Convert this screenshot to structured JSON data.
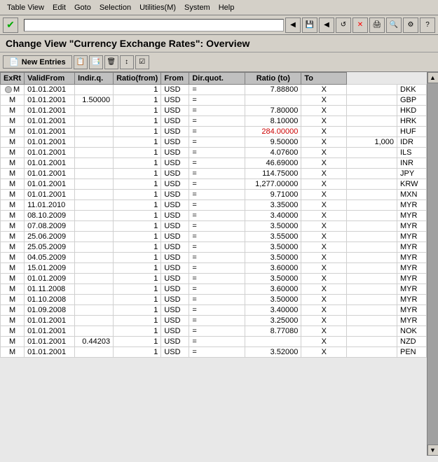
{
  "menubar": {
    "items": [
      {
        "label": "Table View"
      },
      {
        "label": "Edit"
      },
      {
        "label": "Goto"
      },
      {
        "label": "Selection"
      },
      {
        "label": "Utilities(M)"
      },
      {
        "label": "System"
      },
      {
        "label": "Help"
      }
    ]
  },
  "toolbar": {
    "address": ""
  },
  "page": {
    "title": "Change View \"Currency Exchange Rates\": Overview"
  },
  "toolbar2": {
    "new_entries_label": "New Entries"
  },
  "table": {
    "headers": [
      "ExRt",
      "ValidFrom",
      "Indir.q.",
      "Ratio(from)",
      "From",
      "Dir.quot.",
      "Ratio (to)",
      "To"
    ],
    "rows": [
      {
        "exrt": "M",
        "validfrom": "01.01.2001",
        "indirq": "",
        "ratiofrom": "1",
        "from": "USD",
        "eq": "=",
        "dirquot": "7.88800",
        "ratioto": "X",
        "ratio_to": "",
        "to": "DKK",
        "red": false
      },
      {
        "exrt": "M",
        "validfrom": "01.01.2001",
        "indirq": "1.50000",
        "ratiofrom": "1",
        "from": "USD",
        "eq": "=",
        "dirquot": "",
        "ratioto": "X",
        "ratio_to": "",
        "to": "GBP",
        "red": false
      },
      {
        "exrt": "M",
        "validfrom": "01.01.2001",
        "indirq": "",
        "ratiofrom": "1",
        "from": "USD",
        "eq": "=",
        "dirquot": "7.80000",
        "ratioto": "X",
        "ratio_to": "",
        "to": "HKD",
        "red": false
      },
      {
        "exrt": "M",
        "validfrom": "01.01.2001",
        "indirq": "",
        "ratiofrom": "1",
        "from": "USD",
        "eq": "=",
        "dirquot": "8.10000",
        "ratioto": "X",
        "ratio_to": "",
        "to": "HRK",
        "red": false
      },
      {
        "exrt": "M",
        "validfrom": "01.01.2001",
        "indirq": "",
        "ratiofrom": "1",
        "from": "USD",
        "eq": "=",
        "dirquot": "284.00000",
        "ratioto": "X",
        "ratio_to": "",
        "to": "HUF",
        "red": true
      },
      {
        "exrt": "M",
        "validfrom": "01.01.2001",
        "indirq": "",
        "ratiofrom": "1",
        "from": "USD",
        "eq": "=",
        "dirquot": "9.50000",
        "ratioto": "X",
        "ratio_to": "1,000",
        "to": "IDR",
        "red": false
      },
      {
        "exrt": "M",
        "validfrom": "01.01.2001",
        "indirq": "",
        "ratiofrom": "1",
        "from": "USD",
        "eq": "=",
        "dirquot": "4.07600",
        "ratioto": "X",
        "ratio_to": "",
        "to": "ILS",
        "red": false
      },
      {
        "exrt": "M",
        "validfrom": "01.01.2001",
        "indirq": "",
        "ratiofrom": "1",
        "from": "USD",
        "eq": "=",
        "dirquot": "46.69000",
        "ratioto": "X",
        "ratio_to": "",
        "to": "INR",
        "red": false
      },
      {
        "exrt": "M",
        "validfrom": "01.01.2001",
        "indirq": "",
        "ratiofrom": "1",
        "from": "USD",
        "eq": "=",
        "dirquot": "114.75000",
        "ratioto": "X",
        "ratio_to": "",
        "to": "JPY",
        "red": false
      },
      {
        "exrt": "M",
        "validfrom": "01.01.2001",
        "indirq": "",
        "ratiofrom": "1",
        "from": "USD",
        "eq": "=",
        "dirquot": "1,277.00000",
        "ratioto": "X",
        "ratio_to": "",
        "to": "KRW",
        "red": false
      },
      {
        "exrt": "M",
        "validfrom": "01.01.2001",
        "indirq": "",
        "ratiofrom": "1",
        "from": "USD",
        "eq": "=",
        "dirquot": "9.71000",
        "ratioto": "X",
        "ratio_to": "",
        "to": "MXN",
        "red": false
      },
      {
        "exrt": "M",
        "validfrom": "11.01.2010",
        "indirq": "",
        "ratiofrom": "1",
        "from": "USD",
        "eq": "=",
        "dirquot": "3.35000",
        "ratioto": "X",
        "ratio_to": "",
        "to": "MYR",
        "red": false
      },
      {
        "exrt": "M",
        "validfrom": "08.10.2009",
        "indirq": "",
        "ratiofrom": "1",
        "from": "USD",
        "eq": "=",
        "dirquot": "3.40000",
        "ratioto": "X",
        "ratio_to": "",
        "to": "MYR",
        "red": false
      },
      {
        "exrt": "M",
        "validfrom": "07.08.2009",
        "indirq": "",
        "ratiofrom": "1",
        "from": "USD",
        "eq": "=",
        "dirquot": "3.50000",
        "ratioto": "X",
        "ratio_to": "",
        "to": "MYR",
        "red": false
      },
      {
        "exrt": "M",
        "validfrom": "25.06.2009",
        "indirq": "",
        "ratiofrom": "1",
        "from": "USD",
        "eq": "=",
        "dirquot": "3.55000",
        "ratioto": "X",
        "ratio_to": "",
        "to": "MYR",
        "red": false
      },
      {
        "exrt": "M",
        "validfrom": "25.05.2009",
        "indirq": "",
        "ratiofrom": "1",
        "from": "USD",
        "eq": "=",
        "dirquot": "3.50000",
        "ratioto": "X",
        "ratio_to": "",
        "to": "MYR",
        "red": false
      },
      {
        "exrt": "M",
        "validfrom": "04.05.2009",
        "indirq": "",
        "ratiofrom": "1",
        "from": "USD",
        "eq": "=",
        "dirquot": "3.50000",
        "ratioto": "X",
        "ratio_to": "",
        "to": "MYR",
        "red": false
      },
      {
        "exrt": "M",
        "validfrom": "15.01.2009",
        "indirq": "",
        "ratiofrom": "1",
        "from": "USD",
        "eq": "=",
        "dirquot": "3.60000",
        "ratioto": "X",
        "ratio_to": "",
        "to": "MYR",
        "red": false
      },
      {
        "exrt": "M",
        "validfrom": "01.01.2009",
        "indirq": "",
        "ratiofrom": "1",
        "from": "USD",
        "eq": "=",
        "dirquot": "3.50000",
        "ratioto": "X",
        "ratio_to": "",
        "to": "MYR",
        "red": false
      },
      {
        "exrt": "M",
        "validfrom": "01.11.2008",
        "indirq": "",
        "ratiofrom": "1",
        "from": "USD",
        "eq": "=",
        "dirquot": "3.60000",
        "ratioto": "X",
        "ratio_to": "",
        "to": "MYR",
        "red": false
      },
      {
        "exrt": "M",
        "validfrom": "01.10.2008",
        "indirq": "",
        "ratiofrom": "1",
        "from": "USD",
        "eq": "=",
        "dirquot": "3.50000",
        "ratioto": "X",
        "ratio_to": "",
        "to": "MYR",
        "red": false
      },
      {
        "exrt": "M",
        "validfrom": "01.09.2008",
        "indirq": "",
        "ratiofrom": "1",
        "from": "USD",
        "eq": "=",
        "dirquot": "3.40000",
        "ratioto": "X",
        "ratio_to": "",
        "to": "MYR",
        "red": false
      },
      {
        "exrt": "M",
        "validfrom": "01.01.2001",
        "indirq": "",
        "ratiofrom": "1",
        "from": "USD",
        "eq": "=",
        "dirquot": "3.25000",
        "ratioto": "X",
        "ratio_to": "",
        "to": "MYR",
        "red": false
      },
      {
        "exrt": "M",
        "validfrom": "01.01.2001",
        "indirq": "",
        "ratiofrom": "1",
        "from": "USD",
        "eq": "=",
        "dirquot": "8.77080",
        "ratioto": "X",
        "ratio_to": "",
        "to": "NOK",
        "red": false
      },
      {
        "exrt": "M",
        "validfrom": "01.01.2001",
        "indirq": "0.44203",
        "ratiofrom": "1",
        "from": "USD",
        "eq": "=",
        "dirquot": "",
        "ratioto": "X",
        "ratio_to": "",
        "to": "NZD",
        "red": false
      },
      {
        "exrt": "M",
        "validfrom": "01.01.2001",
        "indirq": "",
        "ratiofrom": "1",
        "from": "USD",
        "eq": "=",
        "dirquot": "3.52000",
        "ratioto": "X",
        "ratio_to": "",
        "to": "PEN",
        "red": false
      }
    ]
  }
}
